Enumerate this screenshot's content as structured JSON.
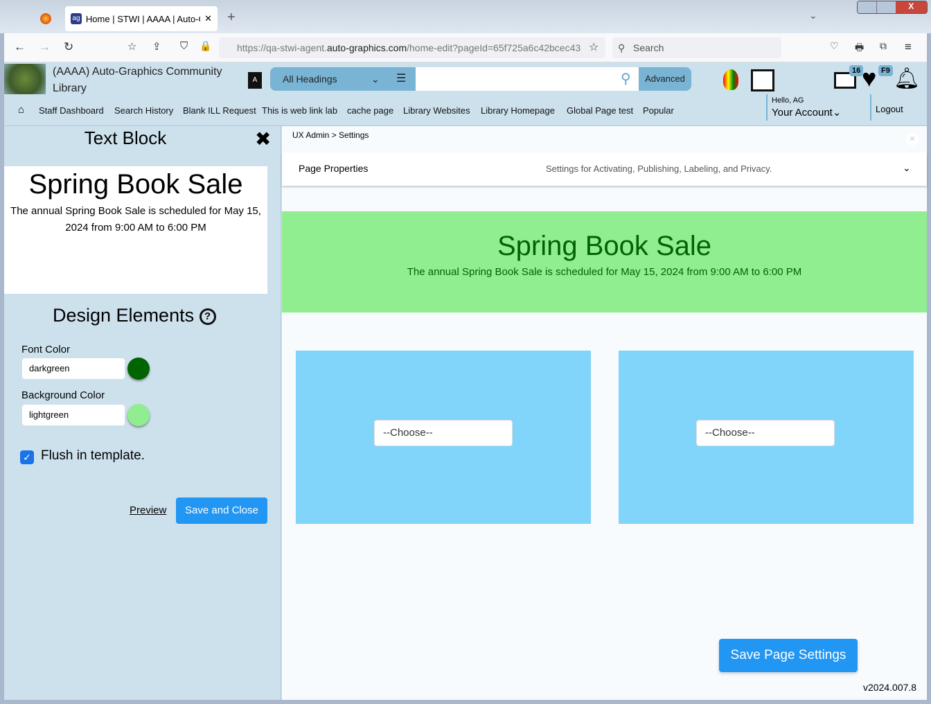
{
  "browser": {
    "tab_title": "Home | STWI | AAAA | Auto-Graphics",
    "url_prefix": "https://qa-stwi-agent.",
    "url_domain": "auto-graphics.com",
    "url_path": "/home-edit?pageId=65f725a6c42bcec43",
    "search_placeholder": "Search"
  },
  "header": {
    "library_name": "(AAAA) Auto-Graphics Community Library",
    "search_scope": "All Headings",
    "advanced_label": "Advanced",
    "list_count": "16",
    "fav_badge": "F9",
    "hello": "Hello, AG",
    "account": "Your Account",
    "logout": "Logout"
  },
  "nav": [
    "Staff Dashboard",
    "Search History",
    "Blank ILL Request",
    "This is web link lab",
    "cache page",
    "Library Websites",
    "Library Homepage",
    "Global Page test",
    "Popular"
  ],
  "editor": {
    "title": "Text Block",
    "preview_heading": "Spring Book Sale",
    "preview_text": "The annual Spring Book Sale is scheduled for May 15, 2024 from 9:00 AM to 6:00 PM",
    "design_title": "Design Elements",
    "font_color_label": "Font Color",
    "font_color": "darkgreen",
    "bg_color_label": "Background Color",
    "bg_color": "lightgreen",
    "flush_label": "Flush in template.",
    "flush_checked": true,
    "preview_link": "Preview",
    "save_close": "Save and Close",
    "colors": {
      "font": "#006400",
      "background": "#90ee90"
    }
  },
  "main": {
    "breadcrumb": [
      "UX Admin",
      "Settings"
    ],
    "page_props_title": "Page Properties",
    "page_props_desc": "Settings for Activating, Publishing, Labeling, and Privacy.",
    "banner_heading": "Spring Book Sale",
    "banner_text": "The annual Spring Book Sale is scheduled for May 15, 2024 from 9:00 AM to 6:00 PM",
    "choose1": "--Choose--",
    "choose2": "--Choose--",
    "save_page": "Save Page Settings",
    "version": "v2024.007.8"
  }
}
